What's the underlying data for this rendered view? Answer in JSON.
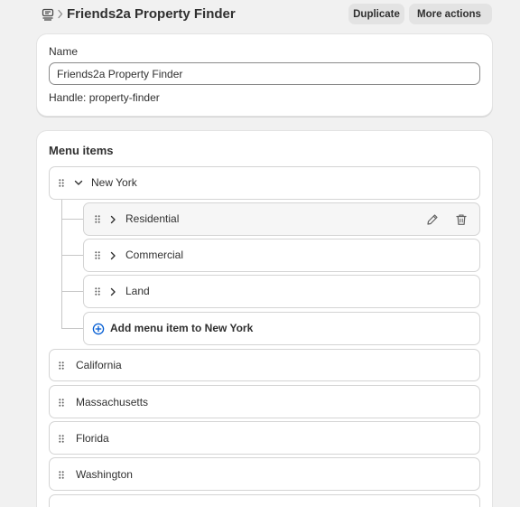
{
  "header": {
    "title": "Friends2a Property Finder",
    "duplicate_label": "Duplicate",
    "more_actions_label": "More actions"
  },
  "name_card": {
    "label": "Name",
    "value": "Friends2a Property Finder",
    "handle_prefix": "Handle: ",
    "handle_value": "property-finder"
  },
  "menu": {
    "title": "Menu items",
    "parent": {
      "label": "New York"
    },
    "children": [
      {
        "label": "Residential"
      },
      {
        "label": "Commercial"
      },
      {
        "label": "Land"
      }
    ],
    "add_label": "Add menu item to New York",
    "top_items": [
      {
        "label": "California"
      },
      {
        "label": "Massachusetts"
      },
      {
        "label": "Florida"
      },
      {
        "label": "Washington"
      }
    ]
  },
  "colors": {
    "background": "#f1f1f1",
    "card": "#ffffff",
    "accent": "#005bd3",
    "text": "#303030"
  },
  "icons": {
    "nav": "navigation-menu-icon",
    "drag": "drag-handle-icon",
    "expand": "chevron-right-icon",
    "collapse": "chevron-down-icon",
    "edit": "pencil-icon",
    "delete": "trash-icon",
    "add": "plus-circle-icon"
  }
}
